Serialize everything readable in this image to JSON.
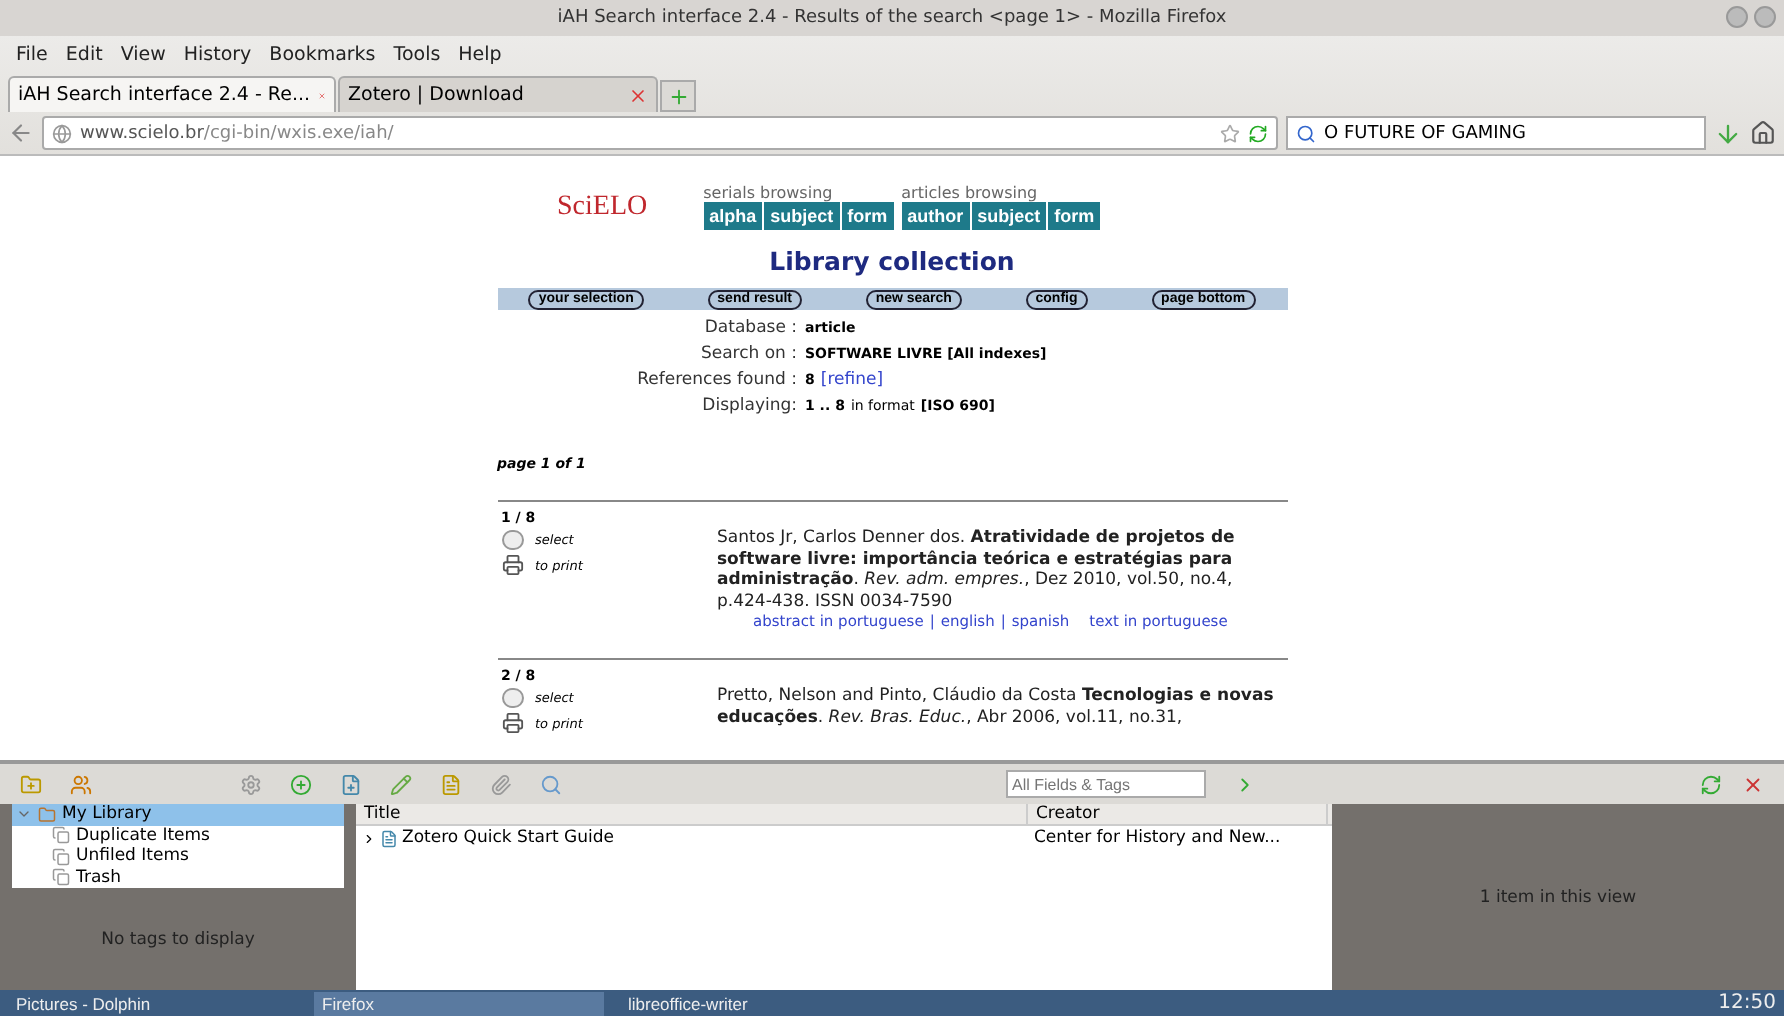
{
  "window": {
    "title": "iAH Search interface 2.4 - Results of the search <page 1> - Mozilla Firefox"
  },
  "menu": [
    "File",
    "Edit",
    "View",
    "History",
    "Bookmarks",
    "Tools",
    "Help"
  ],
  "tabs": [
    {
      "label": "iAH Search interface 2.4 - Re...",
      "selected": true
    },
    {
      "label": "Zotero | Download",
      "selected": false
    }
  ],
  "address": {
    "host": "www.scielo.br",
    "path": "/cgi-bin/wxis.exe/iah/"
  },
  "search": {
    "value": "O FUTURE OF GAMING"
  },
  "page": {
    "logo": "SciELO",
    "nav_groups": [
      {
        "label": "serials browsing",
        "buttons": [
          "alpha",
          "subject",
          "form"
        ]
      },
      {
        "label": "articles browsing",
        "buttons": [
          "author",
          "subject",
          "form"
        ]
      }
    ],
    "heading": "Library collection",
    "actions": [
      "your selection",
      "send result",
      "new search",
      "config",
      "page bottom"
    ],
    "info": [
      {
        "label": "Database :",
        "value": "article"
      },
      {
        "label": "Search on :",
        "value": "SOFTWARE LIVRE [All indexes]"
      },
      {
        "label": "References found :",
        "value": "8",
        "link": "[refine]"
      },
      {
        "label": "Displaying:",
        "value": "1 .. 8",
        "extra": "in format",
        "format": "[ISO 690]"
      }
    ],
    "pager": "page 1 of 1",
    "records": [
      {
        "index": "1 / 8",
        "select": "select",
        "print": "to print",
        "checked": false,
        "separator": "|",
        "citation": "Santos Jr, Carlos Denner dos. **Atratividade de projetos de software livre: importância teórica e estratégias para administração**. *Rev. adm. empres.*, Dez 2010, vol.50, no.4, p.424-438. ISSN 0034-7590",
        "links": [
          [
            "abstract in portuguese",
            "english",
            "spanish"
          ],
          [
            "text in portuguese"
          ]
        ]
      },
      {
        "index": "2 / 8",
        "select": "select",
        "print": "to print",
        "checked": false,
        "citation": "Pretto, Nelson and Pinto, Cláudio da Costa **Tecnologias e novas educações**. *Rev. Bras. Educ.*, Abr 2006, vol.11, no.31,"
      }
    ]
  },
  "zotero": {
    "search_placeholder": "All Fields & Tags",
    "collections": [
      {
        "label": "My Library",
        "selected": true,
        "expanded": true,
        "children": [
          {
            "label": "Duplicate Items",
            "selected": false
          },
          {
            "label": "Unfiled Items",
            "selected": false
          },
          {
            "label": "Trash",
            "selected": false
          }
        ]
      }
    ],
    "tags_empty": "No tags to display",
    "columns": [
      "Title",
      "Creator"
    ],
    "items": [
      {
        "title": "Zotero Quick Start Guide",
        "creator": "Center for History and New..."
      }
    ],
    "count": "1 item in this view"
  },
  "taskbar": {
    "tasks": [
      {
        "label": "Pictures - Dolphin",
        "selected": false
      },
      {
        "label": "Firefox",
        "selected": true
      },
      {
        "label": "libreoffice-writer",
        "selected": false
      }
    ],
    "clock": "12:50"
  }
}
